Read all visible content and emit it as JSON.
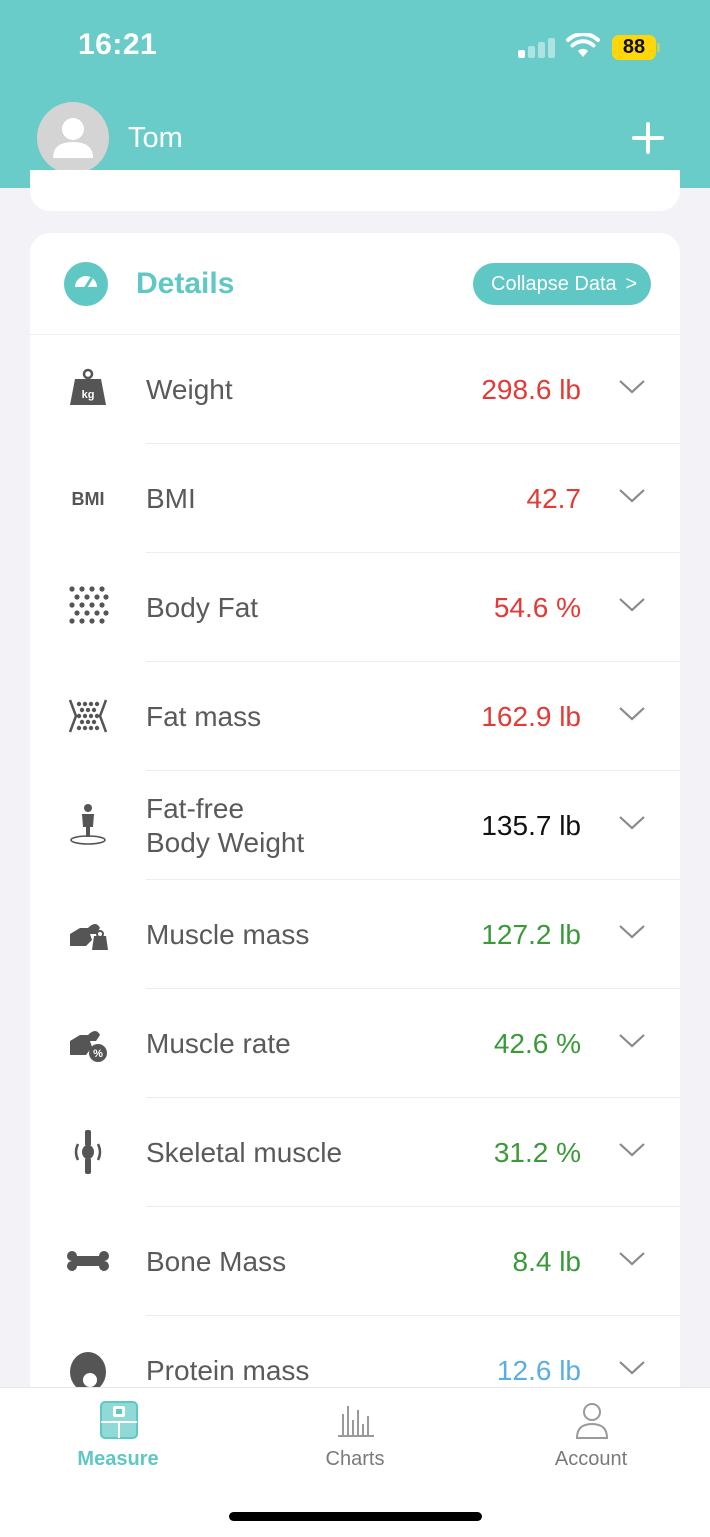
{
  "status_bar": {
    "time": "16:21",
    "battery": "88"
  },
  "header": {
    "user_name": "Tom"
  },
  "details": {
    "title": "Details",
    "collapse_label": "Collapse Data",
    "collapse_chevron": ">",
    "rows": [
      {
        "icon": "weight-icon",
        "label": "Weight",
        "value": "298.6 lb",
        "color": "#e53935"
      },
      {
        "icon": "bmi-icon",
        "label": "BMI",
        "value": "42.7",
        "color": "#e53935"
      },
      {
        "icon": "body-fat-icon",
        "label": "Body Fat",
        "value": "54.6 %",
        "color": "#e53935"
      },
      {
        "icon": "fat-mass-icon",
        "label": "Fat mass",
        "value": "162.9 lb",
        "color": "#e53935"
      },
      {
        "icon": "fat-free-body-icon",
        "label_line1": "Fat-free",
        "label_line2": "Body Weight",
        "value": "135.7 lb",
        "color": "#111111"
      },
      {
        "icon": "muscle-mass-icon",
        "label": "Muscle mass",
        "value": "127.2 lb",
        "color": "#3a9a3a"
      },
      {
        "icon": "muscle-rate-icon",
        "label": "Muscle rate",
        "value": "42.6 %",
        "color": "#3a9a3a"
      },
      {
        "icon": "skeletal-muscle-icon",
        "label": "Skeletal muscle",
        "value": "31.2 %",
        "color": "#3a9a3a"
      },
      {
        "icon": "bone-mass-icon",
        "label": "Bone Mass",
        "value": "8.4 lb",
        "color": "#3a9a3a"
      },
      {
        "icon": "protein-mass-icon",
        "label": "Protein mass",
        "value": "12.6 lb",
        "color": "#5aaee6"
      }
    ]
  },
  "tabs": [
    {
      "label": "Measure",
      "active": true
    },
    {
      "label": "Charts",
      "active": false
    },
    {
      "label": "Account",
      "active": false
    }
  ],
  "colors": {
    "header": "#6accc9",
    "accent": "#5fc7c4",
    "bad": "#e53935",
    "good": "#3a9a3a",
    "low": "#5aaee6"
  }
}
